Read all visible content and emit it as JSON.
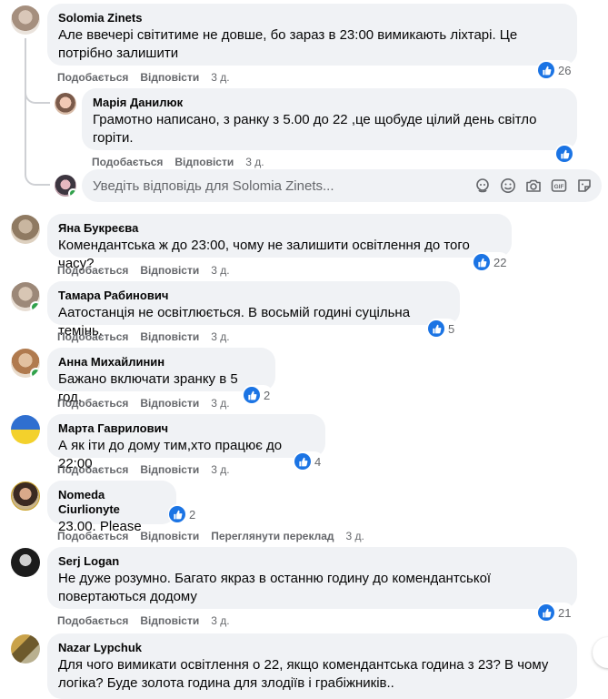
{
  "reply_placeholder": "Уведіть відповідь для Solomia Zinets...",
  "comments": [
    {
      "name": "Solomia Zinets",
      "text": "Але ввечері світитиме не довше, бо зараз в 23:00 вимикають ліхтарі. Це потрібно залишити",
      "like": "Подобається",
      "reply": "Відповісти",
      "time": "3 д.",
      "reactions": "26"
    },
    {
      "name": "Марія Данилюк",
      "text": "Грамотно написано, з ранку з 5.00 до 22 ,це щобуде цілий день світло горіти.",
      "like": "Подобається",
      "reply": "Відповісти",
      "time": "3 д.",
      "reactions": ""
    },
    {
      "name": "Яна Букреєва",
      "text": "Комендантська ж до 23:00, чому не залишити освітлення до того часу?",
      "like": "Подобається",
      "reply": "Відповісти",
      "time": "3 д.",
      "reactions": "22"
    },
    {
      "name": "Тамара Рабинович",
      "text": "Аатостанція не освітлюється. В восьмій годині суцільна темінь.",
      "like": "Подобається",
      "reply": "Відповісти",
      "time": "3 д.",
      "reactions": "5"
    },
    {
      "name": "Анна Михайлинин",
      "text": "Бажано включати зранку в 5 год.",
      "like": "Подобається",
      "reply": "Відповісти",
      "time": "3 д.",
      "reactions": "2"
    },
    {
      "name": "Марта Гаврилович",
      "text": "А як іти до дому тим,хто працює до 22:00",
      "like": "Подобається",
      "reply": "Відповісти",
      "time": "3 д.",
      "reactions": "4"
    },
    {
      "name": "Nomeda Ciurlionyte",
      "text": "23.00. Please",
      "like": "Подобається",
      "reply": "Відповісти",
      "translate": "Переглянути переклад",
      "time": "3 д.",
      "reactions": "2"
    },
    {
      "name": "Serj Logan",
      "text": "Не дуже розумно. Багато якраз в останню годину до комендантської повертаються додому",
      "like": "Подобається",
      "reply": "Відповісти",
      "time": "3 д.",
      "reactions": "21"
    },
    {
      "name": "Nazar Lypchuk",
      "text": "Для чого вимикати освітлення о 22, якщо комендантська година з 23? В чому логіка? Буде золота година для злодіїв і грабіжників..",
      "like": "",
      "reply": "",
      "time": "",
      "reactions": ""
    }
  ],
  "icons": {
    "like": "like-icon",
    "sticker": "sticker-icon",
    "emoji": "emoji-icon",
    "camera": "camera-icon",
    "gif": "gif-icon",
    "avatar_sticker": "avatar-sticker-icon"
  },
  "colors": {
    "accent": "#1b74e4",
    "bubble": "#f0f2f5",
    "muted": "#65676b",
    "online": "#31a24c"
  }
}
